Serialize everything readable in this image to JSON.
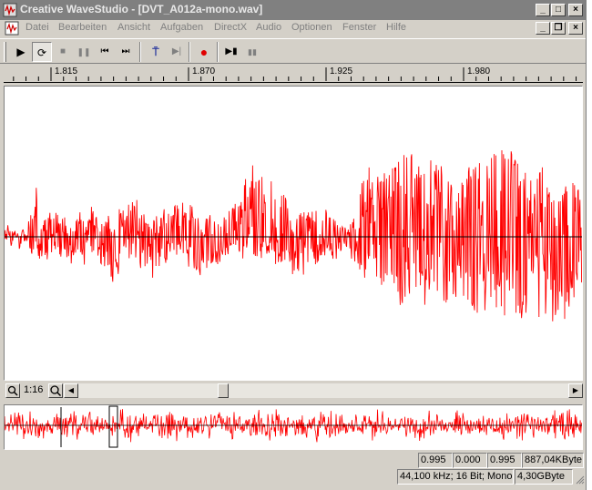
{
  "window": {
    "title": "Creative WaveStudio - [DVT_A012a-mono.wav]"
  },
  "title_buttons": {
    "minimize": "_",
    "maximize": "□",
    "close": "×"
  },
  "doc_buttons": {
    "minimize": "_",
    "restore": "❐",
    "close": "×"
  },
  "menu": [
    "Datei",
    "Bearbeiten",
    "Ansicht",
    "Aufgaben",
    "DirectX",
    "Audio",
    "Optionen",
    "Fenster",
    "Hilfe"
  ],
  "toolbar": {
    "buttons": [
      {
        "name": "play-icon",
        "glyph": "▶"
      },
      {
        "name": "loop-play-icon",
        "glyph": "⟳"
      },
      {
        "name": "stop-icon",
        "glyph": "■"
      },
      {
        "name": "pause-icon",
        "glyph": "❚❚"
      },
      {
        "name": "skip-back-icon",
        "glyph": "⏮"
      },
      {
        "name": "skip-forward-icon",
        "glyph": "⏭"
      },
      {
        "name": "marker-icon",
        "glyph": "⍑"
      },
      {
        "name": "play-to-end-icon",
        "glyph": "▶|"
      },
      {
        "name": "record-icon",
        "glyph": "●"
      },
      {
        "name": "play-selection-icon",
        "glyph": "▶▮"
      },
      {
        "name": "stop-selection-icon",
        "glyph": "▮▮"
      }
    ],
    "colors": {
      "record": "#e00000",
      "marker": "#1a2a9a",
      "icon": "#000000"
    }
  },
  "ruler": {
    "labels": [
      "1.815",
      "1.870",
      "1.925",
      "1.980"
    ]
  },
  "zoom": {
    "level": "1:16"
  },
  "scroll": {
    "position": 0.29
  },
  "status": {
    "start": "0.995",
    "length": "0.000",
    "end": "0.995",
    "size": "887,04KByte",
    "format": "44,100 kHz; 16 Bit; Mono",
    "free": "4,30GByte"
  },
  "colors": {
    "waveform": "#ff0000",
    "background": "#ffffff",
    "centerline": "#000000"
  }
}
